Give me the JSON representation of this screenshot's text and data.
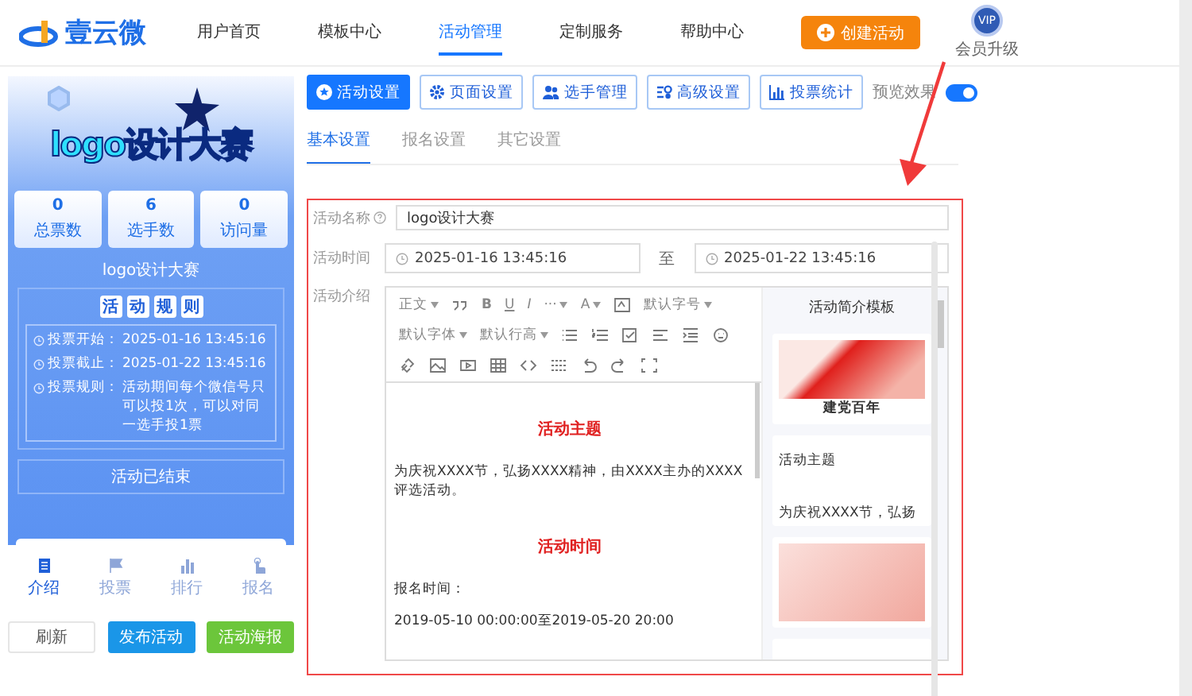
{
  "header": {
    "logo_text": "壹云微",
    "nav": [
      {
        "label": "用户首页",
        "selected": false
      },
      {
        "label": "模板中心",
        "selected": false
      },
      {
        "label": "活动管理",
        "selected": true
      },
      {
        "label": "定制服务",
        "selected": false
      },
      {
        "label": "帮助中心",
        "selected": false
      }
    ],
    "create_button": "创建活动",
    "vip_badge": "VIP",
    "upgrade_label": "会员升级"
  },
  "preview": {
    "title_art": "logo设计大赛",
    "stats": [
      {
        "value": "0",
        "label": "总票数"
      },
      {
        "value": "6",
        "label": "选手数"
      },
      {
        "value": "0",
        "label": "访问量"
      }
    ],
    "name": "logo设计大赛",
    "rules_title": [
      "活",
      "动",
      "规",
      "则"
    ],
    "rules": [
      {
        "label": "投票开始：",
        "value": "2025-01-16 13:45:16"
      },
      {
        "label": "投票截止：",
        "value": "2025-01-22 13:45:16"
      },
      {
        "label": "投票规则：",
        "value": "活动期间每个微信号只可以投1次，可以对同一选手投1票"
      }
    ],
    "status": "活动已结束",
    "bottom_tabs": [
      {
        "kind": "document",
        "label": "介绍",
        "selected": true
      },
      {
        "kind": "flag",
        "label": "投票",
        "selected": false
      },
      {
        "kind": "chart",
        "label": "排行",
        "selected": false
      },
      {
        "kind": "hand",
        "label": "报名",
        "selected": false
      }
    ]
  },
  "actions": [
    {
      "kind": "plain",
      "label": "刷新"
    },
    {
      "kind": "primary",
      "label": "发布活动"
    },
    {
      "kind": "success",
      "label": "活动海报"
    }
  ],
  "toolbar": [
    {
      "kind": "star",
      "label": "活动设置",
      "selected": true
    },
    {
      "kind": "gear",
      "label": "页面设置",
      "selected": false
    },
    {
      "kind": "people",
      "label": "选手管理",
      "selected": false
    },
    {
      "kind": "sliders",
      "label": "高级设置",
      "selected": false
    },
    {
      "kind": "chart",
      "label": "投票统计",
      "selected": false
    }
  ],
  "preview_toggle": {
    "label": "预览效果",
    "on": true
  },
  "subtabs": [
    {
      "label": "基本设置",
      "selected": true
    },
    {
      "label": "报名设置",
      "selected": false
    },
    {
      "label": "其它设置",
      "selected": false
    }
  ],
  "form": {
    "name_label": "活动名称",
    "name_value": "logo设计大赛",
    "time_label": "活动时间",
    "start": "2025-01-16 13:45:16",
    "separator": "至",
    "end": "2025-01-22 13:45:16",
    "intro_label": "活动介绍"
  },
  "editor": {
    "tools": [
      {
        "kind": "select",
        "label": "正文"
      },
      {
        "kind": "quote"
      },
      {
        "kind": "letter",
        "label": "B"
      },
      {
        "kind": "underline",
        "label": "U"
      },
      {
        "kind": "italic",
        "label": "I"
      },
      {
        "kind": "select",
        "label": "···"
      },
      {
        "kind": "select",
        "label": "A"
      },
      {
        "kind": "bgcolor"
      },
      {
        "kind": "select",
        "label": "默认字号"
      },
      {
        "kind": "select",
        "label": "默认字体"
      },
      {
        "kind": "select",
        "label": "默认行高"
      },
      {
        "kind": "bullets"
      },
      {
        "kind": "numbers"
      },
      {
        "kind": "todo"
      },
      {
        "kind": "align"
      },
      {
        "kind": "indent"
      },
      {
        "kind": "emoji"
      },
      {
        "kind": "link"
      },
      {
        "kind": "image"
      },
      {
        "kind": "video"
      },
      {
        "kind": "table"
      },
      {
        "kind": "code"
      },
      {
        "kind": "divider"
      },
      {
        "kind": "undo"
      },
      {
        "kind": "redo"
      },
      {
        "kind": "fullscreen"
      }
    ],
    "content": [
      {
        "kind": "heading",
        "text": "活动主题"
      },
      {
        "kind": "text",
        "text": "为庆祝XXXX节，弘扬XXXX精神，由XXXX主办的XXXX评选活动。"
      },
      {
        "kind": "heading",
        "text": "活动时间"
      },
      {
        "kind": "text",
        "text": "报名时间："
      },
      {
        "kind": "text",
        "text": "2019-05-10 00:00:00至2019-05-20 20:00"
      }
    ],
    "templates_title": "活动简介模板",
    "templates": [
      {
        "kind": "image",
        "caption": "建党百年"
      },
      {
        "kind": "text",
        "title": "活动主题",
        "text": "为庆祝XXXX节，弘扬"
      },
      {
        "kind": "pink"
      },
      {
        "kind": "blank"
      }
    ]
  }
}
